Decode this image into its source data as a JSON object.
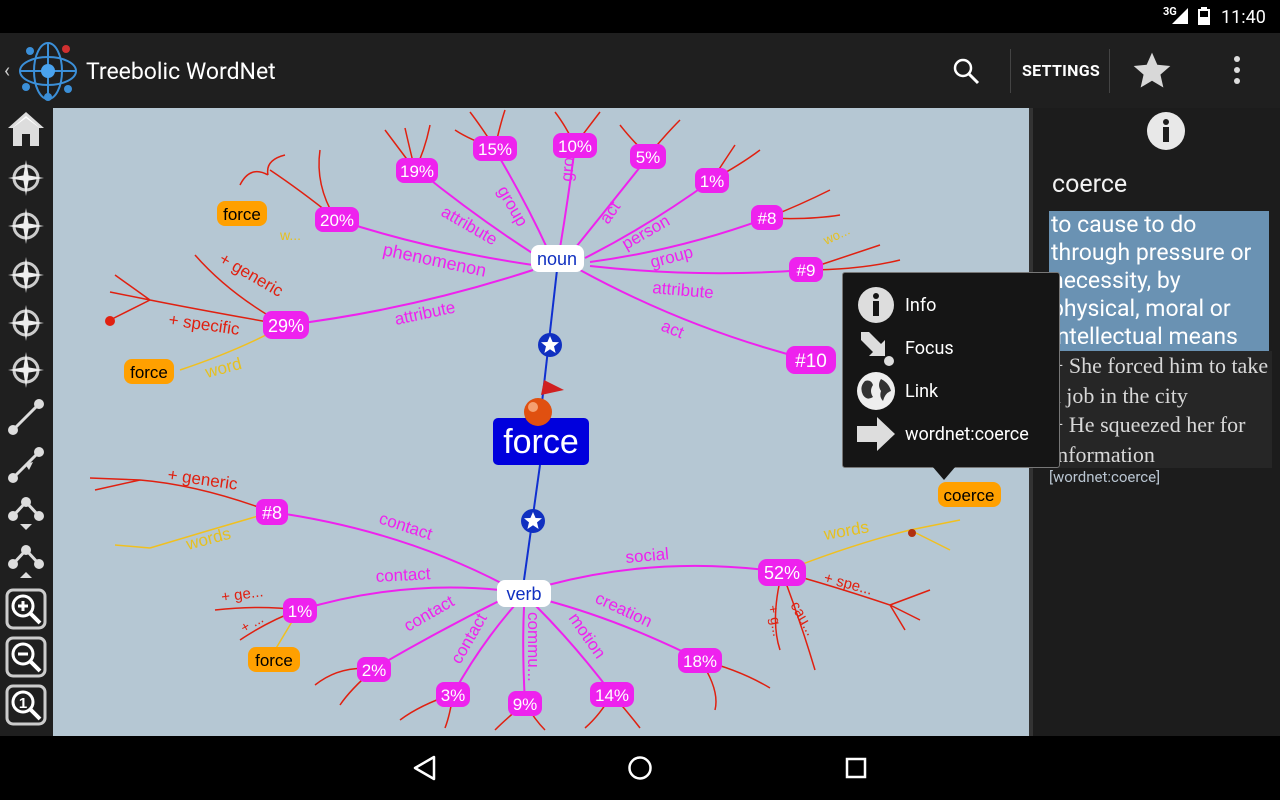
{
  "status_bar": {
    "network": "3G",
    "time": "11:40"
  },
  "app": {
    "title": "Treebolic WordNet",
    "settings_label": "SETTINGS"
  },
  "toolbar": {
    "tools": [
      "home-icon",
      "compass-icon",
      "compass-icon",
      "compass-icon",
      "compass-icon",
      "compass-icon",
      "edge-icon",
      "edge-icon",
      "tree-icon",
      "tree-icon",
      "zoom-in-icon",
      "zoom-out-icon",
      "zoom-reset-icon"
    ],
    "reset_label": "1"
  },
  "graph": {
    "root": {
      "label": "force"
    },
    "noun": {
      "label": "noun"
    },
    "verb": {
      "label": "verb"
    },
    "noun_children": [
      {
        "label": "19%",
        "edge": "attribute"
      },
      {
        "label": "15%",
        "edge": "group"
      },
      {
        "label": "10%",
        "edge": "group"
      },
      {
        "label": "5%",
        "edge": "act"
      },
      {
        "label": "1%",
        "edge": "person"
      },
      {
        "label": "#8",
        "edge": "group"
      },
      {
        "label": "#9",
        "edge": "attribute"
      },
      {
        "label": "#10",
        "edge": "act"
      },
      {
        "label": "20%",
        "edge": "phenomenon"
      },
      {
        "label": "29%",
        "edge": "attribute"
      }
    ],
    "verb_children": [
      {
        "label": "#8",
        "edge": "contact"
      },
      {
        "label": "1%",
        "edge": "contact"
      },
      {
        "label": "2%",
        "edge": "contact"
      },
      {
        "label": "3%",
        "edge": "contact"
      },
      {
        "label": "9%",
        "edge": "commu..."
      },
      {
        "label": "14%",
        "edge": "motion"
      },
      {
        "label": "18%",
        "edge": "creation"
      },
      {
        "label": "52%",
        "edge": "social"
      }
    ],
    "orange_words": [
      "force",
      "force",
      "force",
      "coerce"
    ],
    "minor_labels": [
      "+ generic",
      "+ specific",
      "word",
      "+ generic",
      "words",
      "+ ge...",
      "+ ...",
      "words",
      "+ spe...",
      "cau...",
      "+ g...",
      "w...",
      "wo..."
    ]
  },
  "popup": {
    "items": [
      {
        "icon": "info-icon",
        "label": "Info"
      },
      {
        "icon": "focus-icon",
        "label": "Focus"
      },
      {
        "icon": "globe-icon",
        "label": "Link"
      },
      {
        "icon": "arrow-right-icon",
        "label": "wordnet:coerce"
      }
    ]
  },
  "side_panel": {
    "word": "coerce",
    "definition": "to cause to do through pressure or necessity, by physical, moral or intellectual means",
    "examples": [
      "She forced him to take a job in the city",
      "He squeezed her for information"
    ],
    "link": "[wordnet:coerce]"
  },
  "colors": {
    "node_magenta": "#ee22ee",
    "root_blue": "#0000dd",
    "word_orange": "#ffa000",
    "graph_bg": "#b5c7d3",
    "definition_bg": "#6a92b3"
  }
}
